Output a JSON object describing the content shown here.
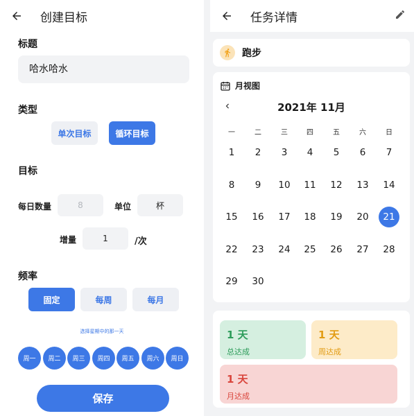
{
  "left": {
    "header": {
      "title": "创建目标"
    },
    "title_section": {
      "heading": "标题",
      "value": "哈水哈水"
    },
    "type_section": {
      "heading": "类型",
      "options": [
        "单次目标",
        "循环目标"
      ],
      "selected": "循环目标"
    },
    "target_section": {
      "heading": "目标",
      "daily_label": "每日数量",
      "daily_placeholder": "8",
      "unit_label": "单位",
      "unit_value": "杯",
      "increment_label": "增量",
      "increment_value": "1",
      "increment_suffix": "/次"
    },
    "frequency_section": {
      "heading": "频率",
      "options": [
        "固定",
        "每周",
        "每月"
      ],
      "selected": "固定",
      "hint": "选择星期中的那一天",
      "weekdays": [
        "周一",
        "周二",
        "周三",
        "周四",
        "周五",
        "周六",
        "周日"
      ]
    },
    "save_label": "保存"
  },
  "right": {
    "header": {
      "title": "任务详情"
    },
    "task": {
      "name": "跑步"
    },
    "calendar": {
      "section_label": "月视图",
      "month_title": "2021年 11月",
      "weekday_headers": [
        "一",
        "二",
        "三",
        "四",
        "五",
        "六",
        "日"
      ],
      "days": [
        "1",
        "2",
        "3",
        "4",
        "5",
        "6",
        "7",
        "8",
        "9",
        "10",
        "11",
        "12",
        "13",
        "14",
        "15",
        "16",
        "17",
        "18",
        "19",
        "20",
        "21",
        "22",
        "23",
        "24",
        "25",
        "26",
        "27",
        "28",
        "29",
        "30"
      ],
      "selected_day": "21"
    },
    "stats": {
      "total": {
        "value": "1 天",
        "label": "总达成"
      },
      "week": {
        "value": "1 天",
        "label": "周达成"
      },
      "month": {
        "value": "1 天",
        "label": "月达成"
      }
    }
  },
  "colors": {
    "accent": "#3d78e6",
    "total": "#2d9c5a",
    "week": "#e29c14",
    "month": "#d9453c"
  },
  "icons": [
    "back-arrow-icon",
    "edit-pencil-icon",
    "running-icon",
    "calendar-icon",
    "chevron-left-icon"
  ]
}
